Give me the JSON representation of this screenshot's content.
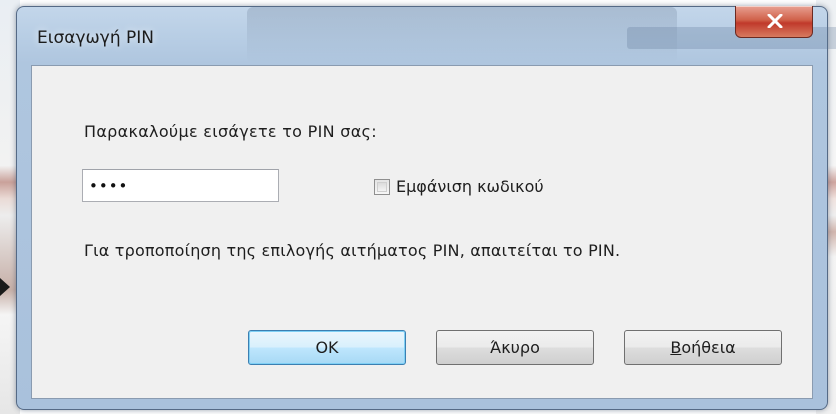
{
  "dialog": {
    "title": "Εισαγωγή PIN",
    "close_icon": "close-icon"
  },
  "prompt": "Παρακαλούμε εισάγετε το PIN σας:",
  "pin_field": {
    "value": "••••"
  },
  "show_password": {
    "label": "Εμφάνιση κωδικού",
    "checked": false
  },
  "info_text": "Για τροποποίηση της επιλογής αιτήματος PIN, απαιτείται το PIN.",
  "buttons": {
    "ok": "OK",
    "cancel": "Άκυρο",
    "help_first_letter": "Β",
    "help_rest": "οήθεια"
  }
}
